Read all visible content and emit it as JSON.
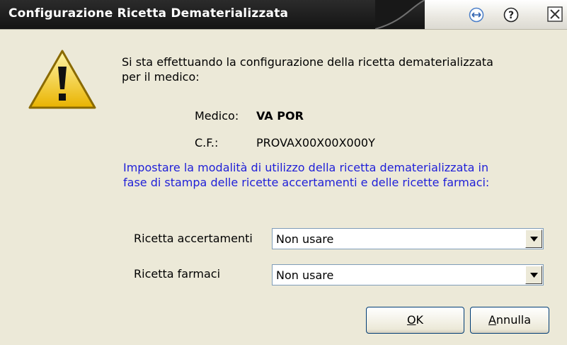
{
  "window": {
    "title": "Configurazione Ricetta Dematerializzata"
  },
  "titlebar_buttons": [
    {
      "icon": "resize-arrows-icon"
    },
    {
      "icon": "help-icon"
    },
    {
      "icon": "close-icon"
    }
  ],
  "warning_icon": "warning-icon",
  "message": {
    "line1": "Si sta effettuando la configurazione della ricetta dematerializzata",
    "line2": "per il medico:"
  },
  "doctor": {
    "medico_label": "Medico:",
    "medico_value": "VA POR",
    "cf_label": "C.F.:",
    "cf_value": "PROVAX00X00X000Y"
  },
  "instructions": {
    "line1": "Impostare la modalità di utilizzo della ricetta dematerializzata in",
    "line2": "fase di stampa delle ricette accertamenti e delle ricette farmaci:",
    "color": "#1f1fd8"
  },
  "fields": {
    "accertamenti_label": "Ricetta accertamenti",
    "accertamenti_value": "Non usare",
    "farmaci_label": "Ricetta farmaci",
    "farmaci_value": "Non usare"
  },
  "buttons": {
    "ok_mnemonic": "O",
    "ok_rest": "K",
    "cancel_mnemonic": "A",
    "cancel_rest": "nnulla"
  }
}
